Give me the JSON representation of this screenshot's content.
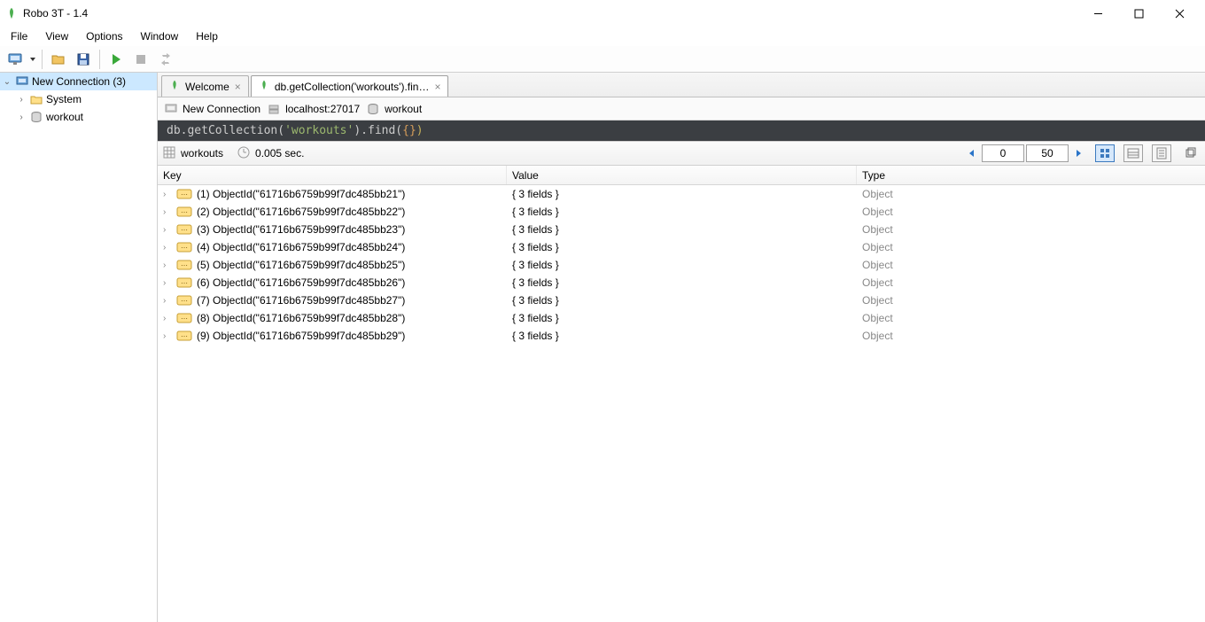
{
  "window": {
    "title": "Robo 3T - 1.4"
  },
  "menu": {
    "items": [
      "File",
      "View",
      "Options",
      "Window",
      "Help"
    ]
  },
  "sidebar": {
    "connection": "New Connection (3)",
    "nodes": [
      {
        "label": "System",
        "icon": "folder"
      },
      {
        "label": "workout",
        "icon": "db"
      }
    ]
  },
  "tabs": [
    {
      "label": "Welcome",
      "active": false
    },
    {
      "label": "db.getCollection('workouts').fin…",
      "active": true
    }
  ],
  "crumb": {
    "connection": "New Connection",
    "host": "localhost:27017",
    "db": "workout"
  },
  "query": {
    "prefix": "db.getCollection(",
    "arg": "'workouts'",
    "mid": ").find(",
    "braces": "{}",
    "end": ")"
  },
  "strip": {
    "collection": "workouts",
    "time": "0.005 sec.",
    "page_start": "0",
    "page_size": "50"
  },
  "columns": {
    "key": "Key",
    "value": "Value",
    "type": "Type"
  },
  "rows": [
    {
      "key": "(1) ObjectId(\"61716b6759b99f7dc485bb21\")",
      "value": "{ 3 fields }",
      "type": "Object"
    },
    {
      "key": "(2) ObjectId(\"61716b6759b99f7dc485bb22\")",
      "value": "{ 3 fields }",
      "type": "Object"
    },
    {
      "key": "(3) ObjectId(\"61716b6759b99f7dc485bb23\")",
      "value": "{ 3 fields }",
      "type": "Object"
    },
    {
      "key": "(4) ObjectId(\"61716b6759b99f7dc485bb24\")",
      "value": "{ 3 fields }",
      "type": "Object"
    },
    {
      "key": "(5) ObjectId(\"61716b6759b99f7dc485bb25\")",
      "value": "{ 3 fields }",
      "type": "Object"
    },
    {
      "key": "(6) ObjectId(\"61716b6759b99f7dc485bb26\")",
      "value": "{ 3 fields }",
      "type": "Object"
    },
    {
      "key": "(7) ObjectId(\"61716b6759b99f7dc485bb27\")",
      "value": "{ 3 fields }",
      "type": "Object"
    },
    {
      "key": "(8) ObjectId(\"61716b6759b99f7dc485bb28\")",
      "value": "{ 3 fields }",
      "type": "Object"
    },
    {
      "key": "(9) ObjectId(\"61716b6759b99f7dc485bb29\")",
      "value": "{ 3 fields }",
      "type": "Object"
    }
  ]
}
